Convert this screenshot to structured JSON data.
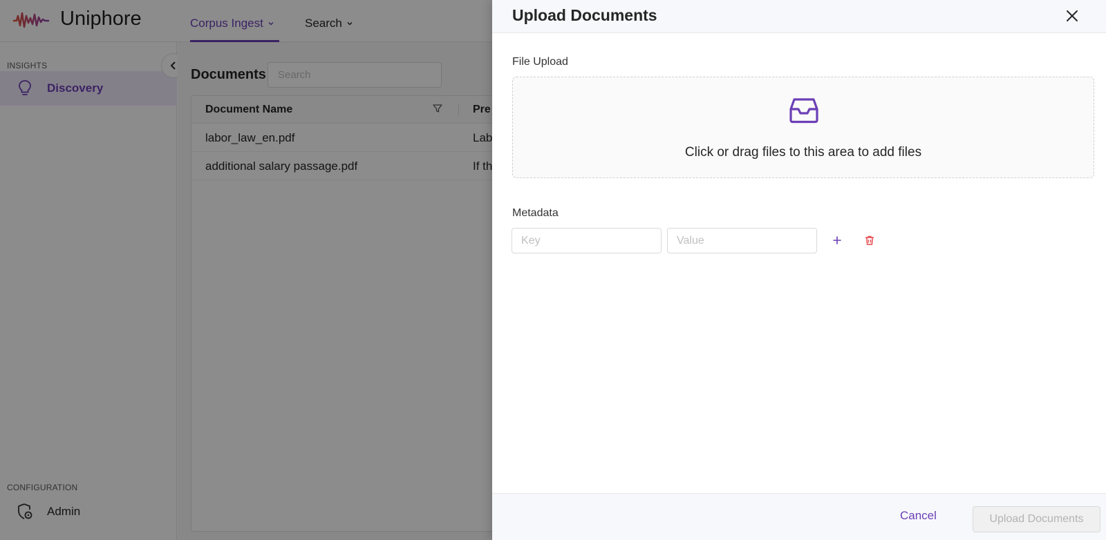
{
  "app": {
    "brand": "Uniphore"
  },
  "nav": {
    "tabs": [
      {
        "label": "Corpus Ingest",
        "active": true
      },
      {
        "label": "Search",
        "active": false
      }
    ]
  },
  "sidebar": {
    "insights_label": "INSIGHTS",
    "discovery_label": "Discovery",
    "configuration_label": "CONFIGURATION",
    "admin_label": "Admin"
  },
  "documents": {
    "title": "Documents",
    "search_placeholder": "Search",
    "columns": [
      "Document Name",
      "Pre"
    ],
    "rows": [
      {
        "name": "labor_law_en.pdf",
        "preview": "Lab"
      },
      {
        "name": "additional salary passage.pdf",
        "preview": "If th"
      }
    ]
  },
  "drawer": {
    "title": "Upload Documents",
    "file_upload_label": "File Upload",
    "dropzone_text": "Click or drag files to this area to add files",
    "metadata_label": "Metadata",
    "key_placeholder": "Key",
    "value_placeholder": "Value",
    "cancel_label": "Cancel",
    "upload_label": "Upload Documents"
  },
  "colors": {
    "accent": "#6b3fb5",
    "danger": "#e5484d",
    "logo_gradient": [
      "#e0533a",
      "#8e3fb5"
    ]
  }
}
